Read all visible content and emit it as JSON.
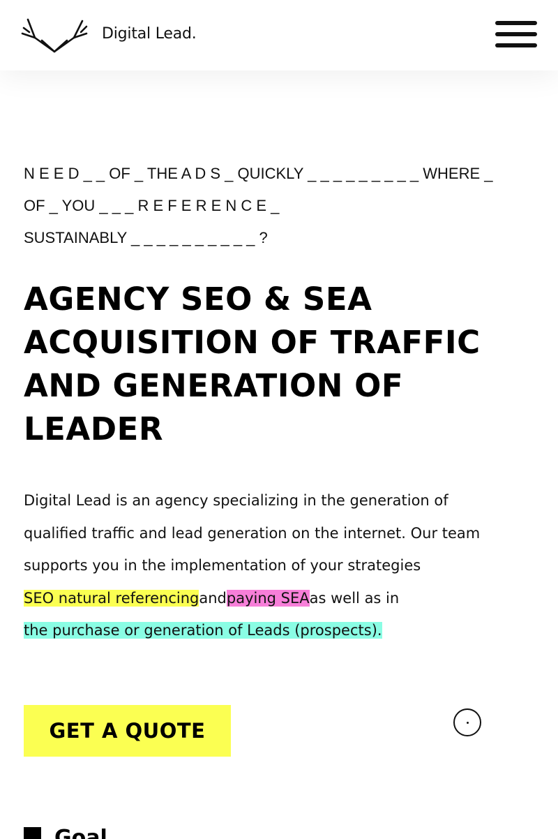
{
  "header": {
    "brand_name": "Digital Lead.",
    "logo_icon": "antler-icon",
    "menu_icon": "hamburger-menu-icon"
  },
  "tagline": {
    "line1": "N E E D _ _ OF _ THE A D S _ QUICKLY _ _ _ _ _ _ _ _ _ WHERE _",
    "line2": "OF _ YOU _ _ _ R E F E R E N C E _",
    "line3": "SUSTAINABLY _ _ _ _ _ _ _ _ _ _ ?"
  },
  "headline": {
    "line1": "AGENCY SEO & SEA",
    "line2": "ACQUISITION OF TRAFFIC",
    "line3": "AND GENERATION OF",
    "line4": "LEADER"
  },
  "intro": {
    "line1": "Digital Lead is an agency specializing in the generation of",
    "line2": "qualified traffic and lead generation on the internet. Our team",
    "line3": "supports you in the implementation of your strategies",
    "highlight_seo": "SEO natural referencing",
    "connector_and": "and",
    "highlight_sea": "paying SEA",
    "connector_as_well": "as well as in",
    "highlight_leads": "the purchase or generation of Leads (prospects)."
  },
  "cta": {
    "quote_label": "GET A QUOTE"
  },
  "colors": {
    "highlight_yellow": "#fbff52",
    "highlight_pink": "#f77fd9",
    "highlight_cyan": "#8afde4",
    "text": "#111111"
  },
  "next_section": {
    "title_partial": "Goal"
  }
}
